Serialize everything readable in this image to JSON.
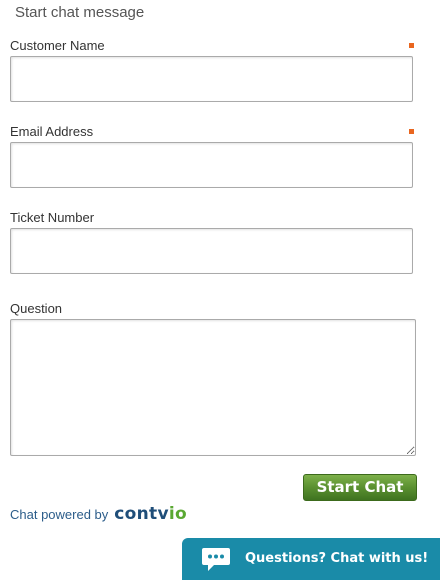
{
  "form": {
    "title": "Start chat message",
    "fields": [
      {
        "label": "Customer Name",
        "value": "",
        "required": true
      },
      {
        "label": "Email Address",
        "value": "",
        "required": true
      },
      {
        "label": "Ticket Number",
        "value": "",
        "required": false
      },
      {
        "label": "Question",
        "value": "",
        "required": false
      }
    ],
    "submit_label": "Start Chat"
  },
  "branding": {
    "powered_by": "Chat powered by",
    "brand_prefix": "cont",
    "brand_suffix": "io",
    "brand_color": "#1f4e79",
    "brand_accent": "#5aa832"
  },
  "chat_widget": {
    "label": "Questions? Chat with us!",
    "icon": "chat-bubble-icon",
    "background": "#1a8ba8"
  },
  "colors": {
    "required_marker": "#e9661f",
    "button_green": "#5a9030"
  }
}
